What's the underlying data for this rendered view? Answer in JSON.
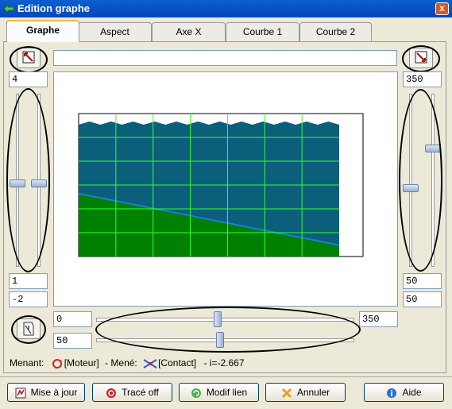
{
  "window": {
    "title": "Edition graphe",
    "close_label": "x"
  },
  "tabs": [
    {
      "label": "Graphe",
      "active": true
    },
    {
      "label": "Aspect"
    },
    {
      "label": "Axe X"
    },
    {
      "label": "Courbe 1"
    },
    {
      "label": "Courbe 2"
    }
  ],
  "top_field": {
    "value": ""
  },
  "left": {
    "top_value": "4",
    "bottom_value": "1",
    "offset_value": "-2",
    "slider_levels": [
      0.52,
      0.52
    ]
  },
  "right": {
    "top_value": "350",
    "bottom_value": "50",
    "offset_value": "50",
    "slider_levels": [
      0.31,
      0.55
    ]
  },
  "x_axis": {
    "min_field": "0",
    "max_field": "350",
    "width_field": "50",
    "slider_levels": [
      0.47,
      0.48
    ]
  },
  "status": {
    "menant_label": "Menant:",
    "menant_value": "[Moteur]",
    "mene_label": "- Mené:",
    "mene_value": "[Contact]",
    "ratio": "- i=-2.667"
  },
  "buttons": {
    "update": "Mise à jour",
    "trace_off": "Tracé off",
    "modif_lien": "Modif lien",
    "cancel": "Annuler",
    "help": "Aide"
  },
  "colors": {
    "upper_fill": "#0b5f7b",
    "lower_fill": "#008000",
    "grid": "#33ff33",
    "ellipse": "#000000"
  },
  "icons": [
    "app-icon",
    "fit-icon",
    "crop-icon",
    "calc-icon",
    "stop-icon",
    "link-icon",
    "cancel-icon",
    "info-icon",
    "motor-icon",
    "contact-icon"
  ],
  "graph": {
    "grid": true,
    "line_start": 0.56,
    "line_end": 0.92
  }
}
